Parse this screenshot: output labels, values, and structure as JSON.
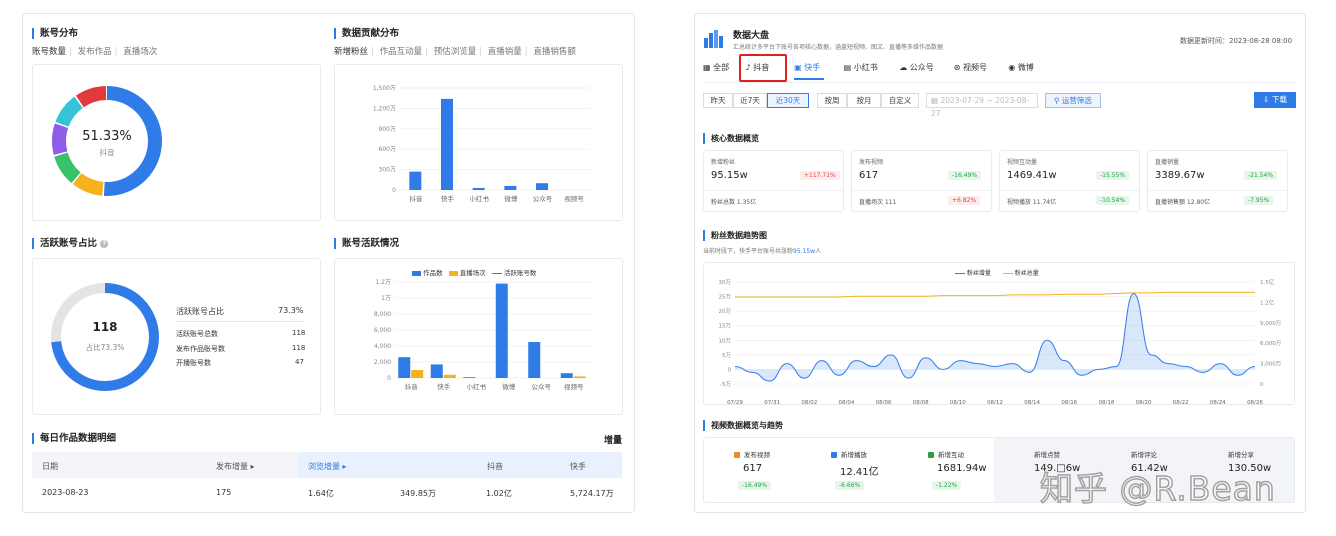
{
  "left": {
    "account_dist": {
      "title": "账号分布",
      "tabs": [
        "账号数量",
        "发布作品",
        "直播场次"
      ],
      "donut_value": "51.33%",
      "donut_label": "抖音",
      "colors": [
        "#2f7be8",
        "#f5b21c",
        "#38c26a",
        "#8e5ce8",
        "#35c3d8",
        "#e23a3a"
      ]
    },
    "contribution": {
      "title": "数据贡献分布",
      "tabs": [
        "新增粉丝",
        "作品互动量",
        "预估浏览量",
        "直播销量",
        "直播销售额"
      ]
    },
    "active_ratio": {
      "title": "活跃账号占比",
      "donut_value": "118",
      "donut_label": "占比73.3%",
      "stats": [
        {
          "label": "活跃账号占比",
          "value": "73.3%"
        },
        {
          "label": "活跃账号总数",
          "value": "118"
        },
        {
          "label": "发布作品账号数",
          "value": "118"
        },
        {
          "label": "开播账号数",
          "value": "47"
        }
      ]
    },
    "activity": {
      "title": "账号活跃情况",
      "legend": [
        "作品数",
        "直播场次",
        "活跃账号数"
      ]
    },
    "daily": {
      "title": "每日作品数据明细",
      "right_label": "增量",
      "headers": [
        "日期",
        "发布增量 ▸",
        "浏览增量 ▸",
        "抖音",
        "快手"
      ],
      "row": [
        "2023-08-23",
        "175",
        "1.64亿",
        "349.85万",
        "1.02亿",
        "5,724.17万"
      ]
    }
  },
  "right": {
    "header": {
      "title": "数据大盘",
      "subtitle": "汇总统计多平台下账号各项核心数据，涵盖短视频、图文、直播等多维作品数据",
      "update": "数据更新时间：2023-08-28 08:00"
    },
    "platform_tabs": [
      "全部",
      "抖音",
      "快手",
      "小红书",
      "公众号",
      "视频号",
      "微博"
    ],
    "time_buttons": [
      "昨天",
      "近7天",
      "近30天"
    ],
    "period_buttons": [
      "按周",
      "按月",
      "自定义"
    ],
    "date_range": "2023-07-29 ~ 2023-08-27",
    "filter_label": "运营筛选",
    "download_label": "下载",
    "core": {
      "title": "核心数据概览",
      "cards": [
        {
          "label": "新增粉丝",
          "value": "95.15w",
          "badge": "+117.71%",
          "up": true,
          "sub": "粉丝总数 1.35亿",
          "badge2": "",
          "up2": false
        },
        {
          "label": "发布视频",
          "value": "617",
          "badge": "-16.49%",
          "up": false,
          "sub": "直播场次 111",
          "badge2": "+6.82%",
          "up2": true
        },
        {
          "label": "视频互动量",
          "value": "1469.41w",
          "badge": "-15.55%",
          "up": false,
          "sub": "视频播放 11.74亿",
          "badge2": "-10.54%",
          "up2": false
        },
        {
          "label": "直播销量",
          "value": "3389.67w",
          "badge": "-21.54%",
          "up": false,
          "sub": "直播销售额 12.80亿",
          "badge2": "-7.95%",
          "up2": false
        }
      ]
    },
    "fans_trend": {
      "title": "粉丝数据趋势图",
      "desc_prefix": "当前时段下，快手平台账号共涨粉",
      "desc_value": "95.15w",
      "desc_suffix": "人",
      "legend": [
        "粉丝增量",
        "粉丝总量"
      ]
    },
    "video": {
      "title": "视频数据概览与趋势",
      "items": [
        {
          "label": "发布视频",
          "value": "617",
          "badge": "-16.49%",
          "color": "#f08a24"
        },
        {
          "label": "新增播放",
          "value": "12.41亿",
          "badge": "-6.66%",
          "color": "#2f7be8"
        },
        {
          "label": "新增互动",
          "value": "1681.94w",
          "badge": "-1.22%",
          "color": "#27a046"
        }
      ],
      "items2": [
        {
          "label": "新增点赞",
          "value": "149.□6w"
        },
        {
          "label": "新增评论",
          "value": "61.42w"
        },
        {
          "label": "新增分享",
          "value": "130.50w"
        }
      ]
    },
    "watermark": "知乎 @R.Bean"
  },
  "chart_data": [
    {
      "type": "bar",
      "id": "contribution",
      "categories": [
        "抖音",
        "快手",
        "小红书",
        "微博",
        "公众号",
        "视频号"
      ],
      "values": [
        270,
        1340,
        30,
        60,
        100,
        0
      ],
      "yticks": [
        "0",
        "300万",
        "600万",
        "900万",
        "1,200万",
        "1,500万"
      ],
      "ylim": [
        0,
        1500
      ],
      "color": "#2f7be8"
    },
    {
      "type": "bar",
      "id": "activity",
      "categories": [
        "抖音",
        "快手",
        "小红书",
        "微博",
        "公众号",
        "视频号"
      ],
      "series": [
        {
          "name": "作品数",
          "values": [
            2600,
            1700,
            100,
            11800,
            4500,
            600
          ],
          "color": "#2f7be8"
        },
        {
          "name": "直播场次",
          "values": [
            1000,
            400,
            0,
            0,
            0,
            200
          ],
          "color": "#f5b21c"
        },
        {
          "name": "活跃账号数",
          "values": [
            0,
            0,
            0,
            0,
            0,
            0
          ],
          "color": "#2f7be8"
        }
      ],
      "yticks": [
        "0",
        "2,000",
        "4,000",
        "6,000",
        "8,000",
        "1万",
        "1.2万"
      ],
      "ylim": [
        0,
        12000
      ]
    },
    {
      "type": "line",
      "id": "fans",
      "x": [
        "07/29",
        "07/31",
        "08/02",
        "08/04",
        "08/06",
        "08/08",
        "08/10",
        "08/12",
        "08/14",
        "08/16",
        "08/18",
        "08/20",
        "08/22",
        "08/24",
        "08/26"
      ],
      "series": [
        {
          "name": "粉丝增量",
          "values": [
            1,
            -1,
            -4,
            2,
            -3,
            3,
            -2,
            3,
            1,
            5,
            -3,
            4,
            0,
            3,
            2,
            1,
            2,
            -1,
            10,
            3,
            -2,
            0,
            1,
            26,
            5,
            2,
            1,
            -1,
            2,
            -2,
            1
          ],
          "color": "#2f7be8"
        },
        {
          "name": "粉丝总量",
          "values": [
            1.28,
            1.28,
            1.28,
            1.28,
            1.28,
            1.28,
            1.28,
            1.29,
            1.29,
            1.29,
            1.29,
            1.29,
            1.3,
            1.3,
            1.3,
            1.3,
            1.31,
            1.31,
            1.31,
            1.32,
            1.32,
            1.32,
            1.33,
            1.34,
            1.34,
            1.35,
            1.35,
            1.35,
            1.35,
            1.35,
            1.35
          ],
          "color": "#f5b21c"
        }
      ],
      "yticks_left": [
        "-5万",
        "0",
        "5万",
        "10万",
        "15万",
        "20万",
        "25万",
        "30万"
      ],
      "yticks_right": [
        "0",
        "3,000万",
        "6,000万",
        "9,000万",
        "1.2亿",
        "1.5亿"
      ],
      "ylim_left": [
        -5,
        30
      ],
      "ylim_right": [
        0,
        1.5
      ]
    }
  ]
}
